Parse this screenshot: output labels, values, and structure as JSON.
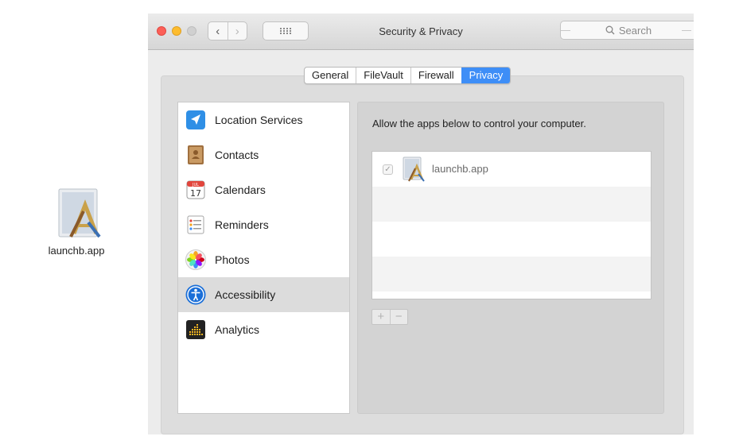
{
  "desktop": {
    "file_label": "launchb.app",
    "file_icon": "app-document-icon"
  },
  "window": {
    "title": "Security & Privacy",
    "search_placeholder": "Search",
    "nav_back": "‹",
    "nav_forward": "›"
  },
  "tabs": [
    {
      "label": "General",
      "active": false
    },
    {
      "label": "FileVault",
      "active": false
    },
    {
      "label": "Firewall",
      "active": false
    },
    {
      "label": "Privacy",
      "active": true
    }
  ],
  "sidebar": {
    "items": [
      {
        "label": "Location Services",
        "icon": "location-arrow-icon"
      },
      {
        "label": "Contacts",
        "icon": "contacts-book-icon"
      },
      {
        "label": "Calendars",
        "icon": "calendar-icon"
      },
      {
        "label": "Reminders",
        "icon": "reminders-list-icon"
      },
      {
        "label": "Photos",
        "icon": "photos-flower-icon"
      },
      {
        "label": "Accessibility",
        "icon": "accessibility-person-icon",
        "selected": true
      },
      {
        "label": "Analytics",
        "icon": "analytics-grid-icon"
      }
    ]
  },
  "calendar_icon": {
    "month": "JUL",
    "day": "17"
  },
  "detail": {
    "heading": "Allow the apps below to control your computer.",
    "apps": [
      {
        "label": "launchb.app",
        "checked": true,
        "check_glyph": "✓"
      }
    ],
    "add_label": "+",
    "remove_label": "−"
  },
  "colors": {
    "tab_active": "#3e8ef7",
    "close": "#fc5f57",
    "minimize": "#fdbc2e",
    "zoom": "#d0d0d0",
    "selected_row": "#dcdcdc"
  }
}
